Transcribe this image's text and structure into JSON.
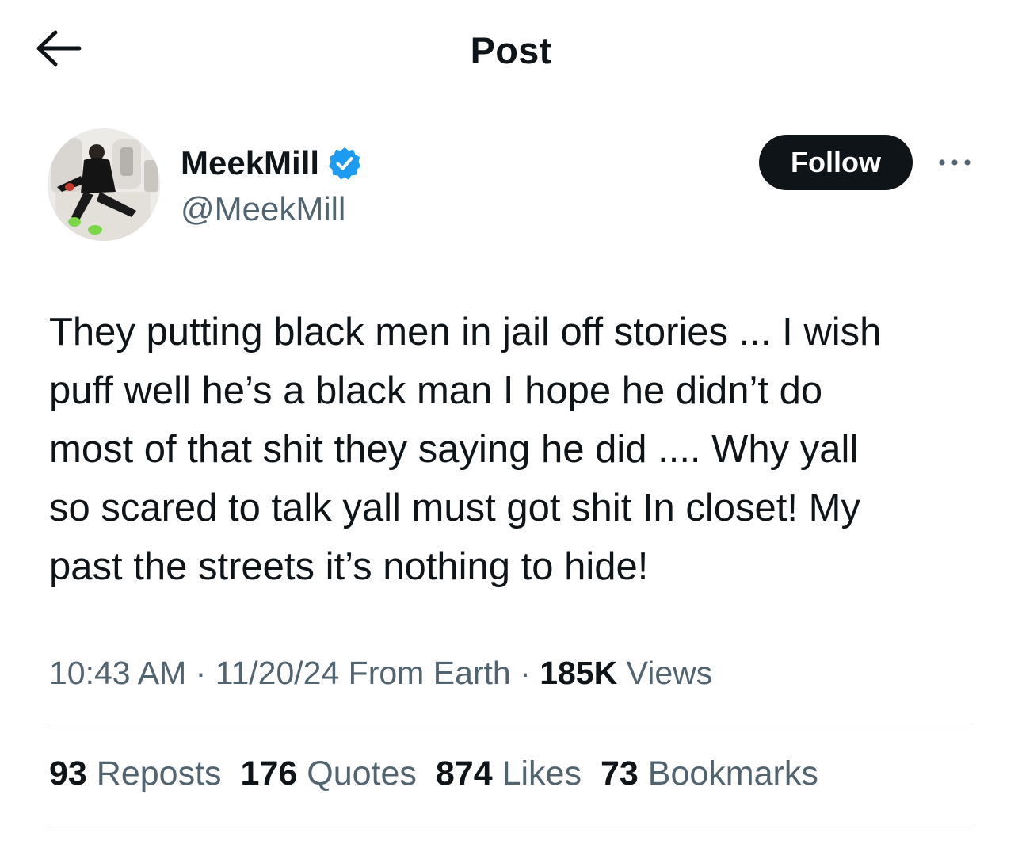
{
  "header": {
    "title": "Post",
    "back_icon": "arrow-left-icon"
  },
  "author": {
    "display_name": "MeekMill",
    "handle": "@MeekMill",
    "verified_icon": "verified-badge-icon",
    "verified_color": "#1d9bf0",
    "follow_label": "Follow",
    "more_icon": "more-horizontal-icon"
  },
  "post": {
    "text": "They putting black men in jail off stories ... I wish\npuff well he’s a black man I hope he didn’t do\nmost of that shit they saying he did .... Why yall\nso scared to talk yall must got shit In closet! My\npast the streets it’s nothing to hide!"
  },
  "meta": {
    "time": "10:43 AM",
    "sep1": "·",
    "date": "11/20/24",
    "location": "From Earth",
    "sep2": "·",
    "views_count": "185K",
    "views_label": "Views"
  },
  "stats": [
    {
      "count": "93",
      "label": "Reposts"
    },
    {
      "count": "176",
      "label": "Quotes"
    },
    {
      "count": "874",
      "label": "Likes"
    },
    {
      "count": "73",
      "label": "Bookmarks"
    }
  ],
  "colors": {
    "text_primary": "#0f1419",
    "text_secondary": "#536471",
    "divider": "#dfe3e6",
    "follow_bg": "#0f1419"
  }
}
